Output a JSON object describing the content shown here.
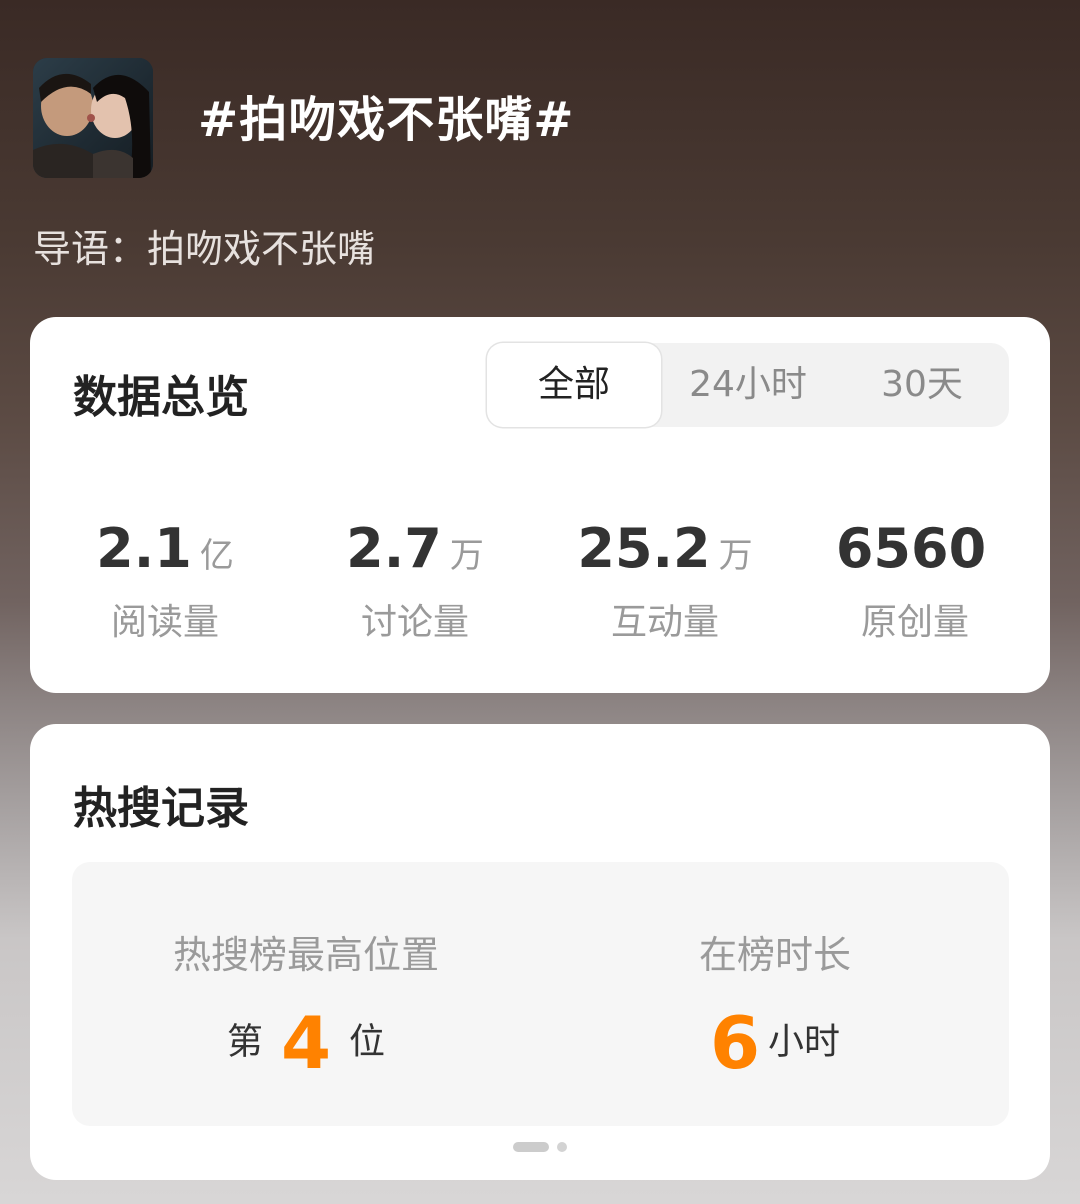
{
  "topic": {
    "title": "#拍吻戏不张嘴#",
    "intro": "导语：拍吻戏不张嘴"
  },
  "overview": {
    "title": "数据总览",
    "tabs": [
      {
        "label": "全部",
        "active": true
      },
      {
        "label": "24小时",
        "active": false
      },
      {
        "label": "30天",
        "active": false
      }
    ],
    "stats": [
      {
        "value": "2.1",
        "unit": "亿",
        "label": "阅读量"
      },
      {
        "value": "2.7",
        "unit": "万",
        "label": "讨论量"
      },
      {
        "value": "25.2",
        "unit": "万",
        "label": "互动量"
      },
      {
        "value": "6560",
        "unit": "",
        "label": "原创量"
      }
    ]
  },
  "hot_search": {
    "title": "热搜记录",
    "best_rank": {
      "label": "热搜榜最高位置",
      "prefix": "第",
      "number": "4",
      "suffix": "位"
    },
    "duration": {
      "label": "在榜时长",
      "number": "6",
      "suffix": "小时"
    },
    "pager": {
      "pages": 2,
      "current": 1
    }
  },
  "colors": {
    "accent": "#ff8200",
    "card_bg": "#ffffff",
    "panel_bg": "#f6f6f6",
    "muted_text": "#9a9a9a",
    "primary_text": "#222222"
  }
}
